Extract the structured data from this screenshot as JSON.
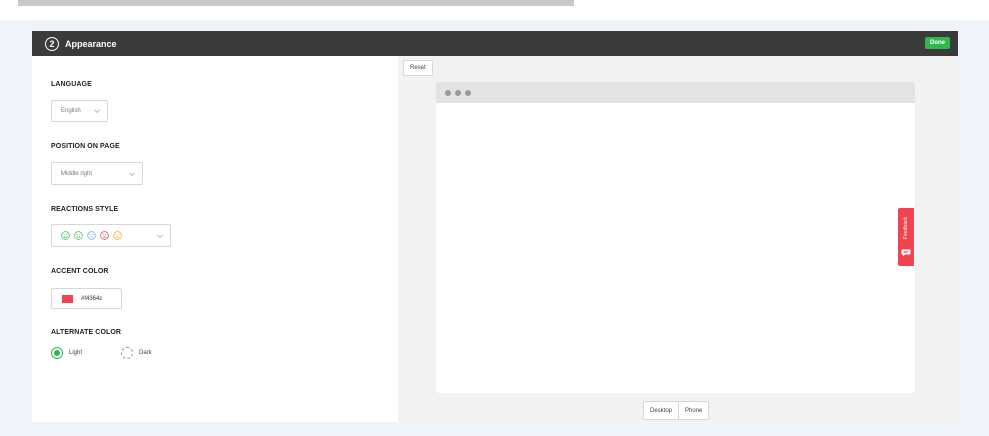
{
  "header": {
    "step_number": "2",
    "title": "Appearance",
    "done_label": "Done"
  },
  "settings": {
    "language": {
      "label": "LANGUAGE",
      "value": "English"
    },
    "position": {
      "label": "POSITION ON PAGE",
      "value": "Middle right"
    },
    "reactions": {
      "label": "REACTIONS STYLE",
      "faces": [
        {
          "icon": "big-smile-face-icon",
          "color": "#3dbb58"
        },
        {
          "icon": "smile-face-icon",
          "color": "#3dbb58"
        },
        {
          "icon": "neutral-face-icon",
          "color": "#7fa8d6"
        },
        {
          "icon": "sad-face-icon",
          "color": "#e5424d"
        },
        {
          "icon": "meh-face-icon",
          "color": "#f0a534"
        }
      ]
    },
    "accent": {
      "label": "ACCENT COLOR",
      "value": "#f4364c",
      "swatch_color": "#f14352"
    },
    "alternate": {
      "label": "ALTERNATE COLOR",
      "options": [
        {
          "label": "Light",
          "selected": true
        },
        {
          "label": "Dark",
          "selected": false
        }
      ]
    }
  },
  "preview": {
    "reset_label": "Reset",
    "feedback_label": "Feedback",
    "feedback_color": "#f2444f",
    "view_options": [
      "Desktop",
      "Phone"
    ]
  }
}
